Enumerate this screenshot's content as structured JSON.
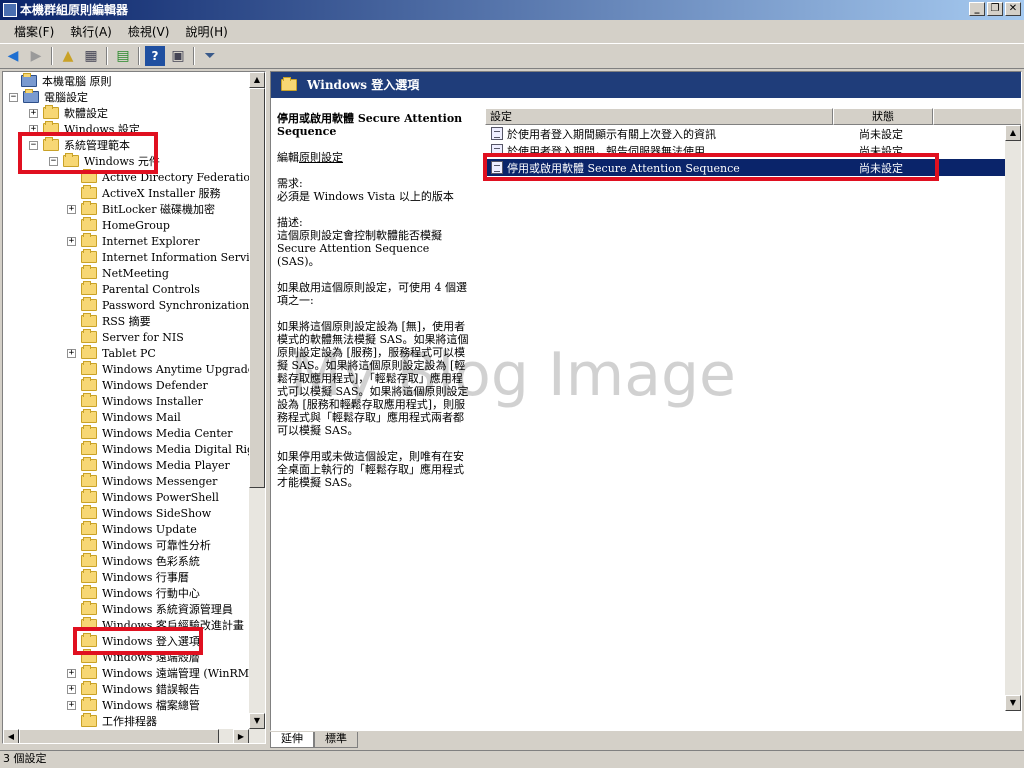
{
  "window": {
    "title": "本機群組原則編輯器",
    "buttons": [
      "_",
      "❐",
      "✕"
    ]
  },
  "menu": [
    "檔案(F)",
    "執行(A)",
    "檢視(V)",
    "說明(H)"
  ],
  "tree": {
    "items": [
      {
        "label": "本機電腦 原則",
        "depth": 0,
        "expander": "",
        "icon": "computer-policy-icon"
      },
      {
        "label": "電腦設定",
        "depth": 1,
        "expander": "−",
        "icon": "computer-icon"
      },
      {
        "label": "軟體設定",
        "depth": 2,
        "expander": "+",
        "icon": "folder-icon"
      },
      {
        "label": "Windows 設定",
        "depth": 2,
        "expander": "+",
        "icon": "folder-icon"
      },
      {
        "label": "系統管理範本",
        "depth": 2,
        "expander": "−",
        "icon": "folder-icon"
      },
      {
        "label": "Windows 元件",
        "depth": 3,
        "expander": "−",
        "icon": "folder-open-icon"
      },
      {
        "label": "Active Directory Federation Ser",
        "depth": 4,
        "expander": "",
        "icon": "folder-icon"
      },
      {
        "label": "ActiveX Installer 服務",
        "depth": 4,
        "expander": "",
        "icon": "folder-icon"
      },
      {
        "label": "BitLocker 磁碟機加密",
        "depth": 4,
        "expander": "+",
        "icon": "folder-icon"
      },
      {
        "label": "HomeGroup",
        "depth": 4,
        "expander": "",
        "icon": "folder-icon"
      },
      {
        "label": "Internet Explorer",
        "depth": 4,
        "expander": "+",
        "icon": "folder-icon"
      },
      {
        "label": "Internet Information Services",
        "depth": 4,
        "expander": "",
        "icon": "folder-icon"
      },
      {
        "label": "NetMeeting",
        "depth": 4,
        "expander": "",
        "icon": "folder-icon"
      },
      {
        "label": "Parental Controls",
        "depth": 4,
        "expander": "",
        "icon": "folder-icon"
      },
      {
        "label": "Password Synchronization",
        "depth": 4,
        "expander": "",
        "icon": "folder-icon"
      },
      {
        "label": "RSS 摘要",
        "depth": 4,
        "expander": "",
        "icon": "folder-icon"
      },
      {
        "label": "Server for NIS",
        "depth": 4,
        "expander": "",
        "icon": "folder-icon"
      },
      {
        "label": "Tablet PC",
        "depth": 4,
        "expander": "+",
        "icon": "folder-icon"
      },
      {
        "label": "Windows Anytime Upgrade",
        "depth": 4,
        "expander": "",
        "icon": "folder-icon"
      },
      {
        "label": "Windows Defender",
        "depth": 4,
        "expander": "",
        "icon": "folder-icon"
      },
      {
        "label": "Windows Installer",
        "depth": 4,
        "expander": "",
        "icon": "folder-icon"
      },
      {
        "label": "Windows Mail",
        "depth": 4,
        "expander": "",
        "icon": "folder-icon"
      },
      {
        "label": "Windows Media Center",
        "depth": 4,
        "expander": "",
        "icon": "folder-icon"
      },
      {
        "label": "Windows Media Digital Rights",
        "depth": 4,
        "expander": "",
        "icon": "folder-icon"
      },
      {
        "label": "Windows Media Player",
        "depth": 4,
        "expander": "",
        "icon": "folder-icon"
      },
      {
        "label": "Windows Messenger",
        "depth": 4,
        "expander": "",
        "icon": "folder-icon"
      },
      {
        "label": "Windows PowerShell",
        "depth": 4,
        "expander": "",
        "icon": "folder-icon"
      },
      {
        "label": "Windows SideShow",
        "depth": 4,
        "expander": "",
        "icon": "folder-icon"
      },
      {
        "label": "Windows Update",
        "depth": 4,
        "expander": "",
        "icon": "folder-icon"
      },
      {
        "label": "Windows 可靠性分析",
        "depth": 4,
        "expander": "",
        "icon": "folder-icon"
      },
      {
        "label": "Windows 色彩系統",
        "depth": 4,
        "expander": "",
        "icon": "folder-icon"
      },
      {
        "label": "Windows 行事曆",
        "depth": 4,
        "expander": "",
        "icon": "folder-icon"
      },
      {
        "label": "Windows 行動中心",
        "depth": 4,
        "expander": "",
        "icon": "folder-icon"
      },
      {
        "label": "Windows 系統資源管理員",
        "depth": 4,
        "expander": "",
        "icon": "folder-icon"
      },
      {
        "label": "Windows 客戶經驗改進計畫",
        "depth": 4,
        "expander": "",
        "icon": "folder-icon"
      },
      {
        "label": "Windows 登入選項",
        "depth": 4,
        "expander": "",
        "icon": "folder-open-icon"
      },
      {
        "label": "Windows 遠端殼層",
        "depth": 4,
        "expander": "",
        "icon": "folder-icon"
      },
      {
        "label": "Windows 遠端管理 (WinRM)",
        "depth": 4,
        "expander": "+",
        "icon": "folder-icon"
      },
      {
        "label": "Windows 錯誤報告",
        "depth": 4,
        "expander": "+",
        "icon": "folder-icon"
      },
      {
        "label": "Windows 檔案總管",
        "depth": 4,
        "expander": "+",
        "icon": "folder-icon"
      },
      {
        "label": "工作排程器",
        "depth": 4,
        "expander": "",
        "icon": "folder-icon"
      }
    ]
  },
  "right": {
    "header_title": "Windows 登入選項",
    "extended": {
      "policy_title": "停用或啟用軟體 Secure Attention Sequence",
      "edit_prefix": "編輯",
      "edit_link": "原則設定",
      "requirements_label": "需求:",
      "requirements_text": "必須是 Windows Vista 以上的版本",
      "description_label": "描述:",
      "description_text": "這個原則設定會控制軟體能否模擬 Secure Attention Sequence (SAS)。",
      "para1": "如果啟用這個原則設定，可使用 4 個選項之一:",
      "para2": "如果將這個原則設定設為 [無]，使用者模式的軟體無法模擬 SAS。如果將這個原則設定設為 [服務]，服務程式可以模擬 SAS。如果將這個原則設定設為 [輕鬆存取應用程式]，「輕鬆存取」應用程式可以模擬 SAS。如果將這個原則設定設為 [服務和輕鬆存取應用程式]，則服務程式與「輕鬆存取」應用程式兩者都可以模擬 SAS。",
      "para3": "如果停用或未做這個設定，則唯有在安全桌面上執行的「輕鬆存取」應用程式才能模擬 SAS。"
    },
    "columns": {
      "setting": "設定",
      "state": "狀態"
    },
    "rows": [
      {
        "name": "於使用者登入期間顯示有關上次登入的資訊",
        "state": "尚未設定",
        "selected": false
      },
      {
        "name": "於使用者登入期間，報告伺服器無法使用",
        "state": "尚未設定",
        "selected": false
      },
      {
        "name": "停用或啟用軟體 Secure Attention Sequence",
        "state": "尚未設定",
        "selected": true
      }
    ]
  },
  "tabs": [
    "延伸",
    "標準"
  ],
  "status": "3 個設定",
  "watermark": "My Blog Image",
  "colors": {
    "highlight": "#e01020",
    "selection": "#0a246a",
    "header": "#1f3d7a"
  }
}
